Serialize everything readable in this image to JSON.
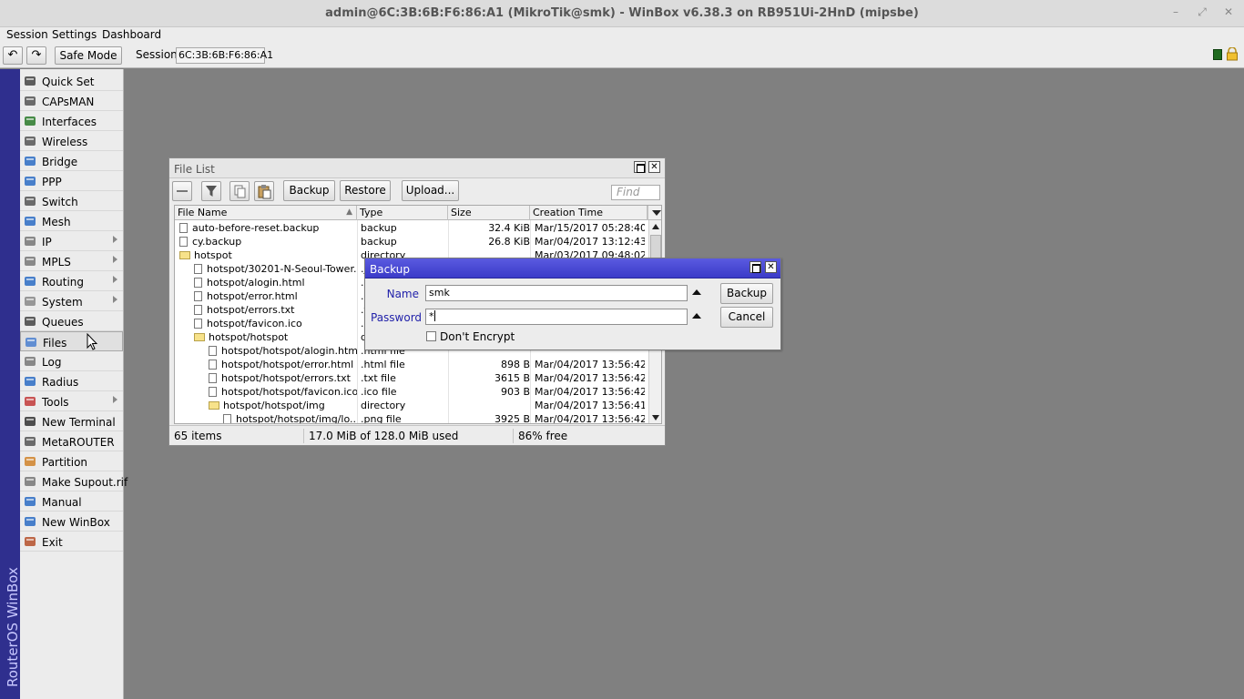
{
  "window": {
    "title": "admin@6C:3B:6B:F6:86:A1 (MikroTik@smk) - WinBox v6.38.3 on RB951Ui-2HnD (mipsbe)",
    "minimize": "–",
    "restore": "⤢",
    "close": "✕"
  },
  "menu": {
    "session": "Session",
    "settings": "Settings",
    "dashboard": "Dashboard"
  },
  "toolbar": {
    "undo": "↶",
    "redo": "↷",
    "safe_mode": "Safe Mode",
    "session_label": "Session:",
    "session_value": "6C:3B:6B:F6:86:A1"
  },
  "brand": "RouterOS WinBox",
  "sidebar": {
    "items": [
      {
        "label": "Quick Set",
        "icon": "quickset-icon",
        "color": "#444"
      },
      {
        "label": "CAPsMAN",
        "icon": "capsman-icon",
        "color": "#555"
      },
      {
        "label": "Interfaces",
        "icon": "interfaces-icon",
        "color": "#2a7a2a"
      },
      {
        "label": "Wireless",
        "icon": "wireless-icon",
        "color": "#555"
      },
      {
        "label": "Bridge",
        "icon": "bridge-icon",
        "color": "#2b6cc4"
      },
      {
        "label": "PPP",
        "icon": "ppp-icon",
        "color": "#2b6cc4"
      },
      {
        "label": "Switch",
        "icon": "switch-icon",
        "color": "#555"
      },
      {
        "label": "Mesh",
        "icon": "mesh-icon",
        "color": "#2b6cc4"
      },
      {
        "label": "IP",
        "icon": "ip-icon",
        "color": "#777",
        "submenu": true
      },
      {
        "label": "MPLS",
        "icon": "mpls-icon",
        "color": "#777",
        "submenu": true
      },
      {
        "label": "Routing",
        "icon": "routing-icon",
        "color": "#2b6cc4",
        "submenu": true
      },
      {
        "label": "System",
        "icon": "system-icon",
        "color": "#888",
        "submenu": true
      },
      {
        "label": "Queues",
        "icon": "queues-icon",
        "color": "#444"
      },
      {
        "label": "Files",
        "icon": "files-icon",
        "color": "#4a7fcf",
        "active": true
      },
      {
        "label": "Log",
        "icon": "log-icon",
        "color": "#777"
      },
      {
        "label": "Radius",
        "icon": "radius-icon",
        "color": "#2b6cc4"
      },
      {
        "label": "Tools",
        "icon": "tools-icon",
        "color": "#c23a3a",
        "submenu": true
      },
      {
        "label": "New Terminal",
        "icon": "terminal-icon",
        "color": "#333"
      },
      {
        "label": "MetaROUTER",
        "icon": "metarouter-icon",
        "color": "#555"
      },
      {
        "label": "Partition",
        "icon": "partition-icon",
        "color": "#d0822a"
      },
      {
        "label": "Make Supout.rif",
        "icon": "supout-icon",
        "color": "#777"
      },
      {
        "label": "Manual",
        "icon": "manual-icon",
        "color": "#2b6cc4"
      },
      {
        "label": "New WinBox",
        "icon": "winbox-icon",
        "color": "#2b6cc4"
      },
      {
        "label": "Exit",
        "icon": "exit-icon",
        "color": "#b5502a"
      }
    ]
  },
  "filelist": {
    "title": "File List",
    "buttons": {
      "backup": "Backup",
      "restore": "Restore",
      "upload": "Upload..."
    },
    "find_placeholder": "Find",
    "columns": [
      "File Name",
      "Type",
      "Size",
      "Creation Time"
    ],
    "rows": [
      {
        "indent": 0,
        "kind": "file",
        "name": "auto-before-reset.backup",
        "type": "backup",
        "size": "32.4 KiB",
        "time": "Mar/15/2017 05:28:40"
      },
      {
        "indent": 0,
        "kind": "file",
        "name": "cy.backup",
        "type": "backup",
        "size": "26.8 KiB",
        "time": "Mar/04/2017 13:12:43"
      },
      {
        "indent": 0,
        "kind": "folder",
        "name": "hotspot",
        "type": "directory",
        "size": "",
        "time": "Mar/03/2017 09:48:02"
      },
      {
        "indent": 1,
        "kind": "file",
        "name": "hotspot/30201-N-Seoul-Tower...",
        "type": ".jpg file",
        "size": "",
        "time": ""
      },
      {
        "indent": 1,
        "kind": "file",
        "name": "hotspot/alogin.html",
        "type": ".html file",
        "size": "",
        "time": ""
      },
      {
        "indent": 1,
        "kind": "file",
        "name": "hotspot/error.html",
        "type": ".html file",
        "size": "",
        "time": ""
      },
      {
        "indent": 1,
        "kind": "file",
        "name": "hotspot/errors.txt",
        "type": ".txt file",
        "size": "",
        "time": ""
      },
      {
        "indent": 1,
        "kind": "file",
        "name": "hotspot/favicon.ico",
        "type": ".ico file",
        "size": "",
        "time": ""
      },
      {
        "indent": 1,
        "kind": "folder",
        "name": "hotspot/hotspot",
        "type": "directory",
        "size": "",
        "time": ""
      },
      {
        "indent": 2,
        "kind": "file",
        "name": "hotspot/hotspot/alogin.html",
        "type": ".html file",
        "size": "",
        "time": ""
      },
      {
        "indent": 2,
        "kind": "file",
        "name": "hotspot/hotspot/error.html",
        "type": ".html file",
        "size": "898 B",
        "time": "Mar/04/2017 13:56:42"
      },
      {
        "indent": 2,
        "kind": "file",
        "name": "hotspot/hotspot/errors.txt",
        "type": ".txt file",
        "size": "3615 B",
        "time": "Mar/04/2017 13:56:42"
      },
      {
        "indent": 2,
        "kind": "file",
        "name": "hotspot/hotspot/favicon.ico",
        "type": ".ico file",
        "size": "903 B",
        "time": "Mar/04/2017 13:56:42"
      },
      {
        "indent": 2,
        "kind": "folder",
        "name": "hotspot/hotspot/img",
        "type": "directory",
        "size": "",
        "time": "Mar/04/2017 13:56:41"
      },
      {
        "indent": 3,
        "kind": "file",
        "name": "hotspot/hotspot/img/lo...",
        "type": ".png file",
        "size": "3925 B",
        "time": "Mar/04/2017 13:56:42"
      }
    ],
    "status": {
      "items": "65 items",
      "used": "17.0 MiB of 128.0 MiB used",
      "free": "86% free"
    }
  },
  "backup_dialog": {
    "title": "Backup",
    "name_label": "Name",
    "name_value": "smk",
    "password_label": "Password",
    "password_value": "*",
    "dont_encrypt_label": "Don't Encrypt",
    "dont_encrypt_checked": false,
    "backup_button": "Backup",
    "cancel_button": "Cancel"
  }
}
